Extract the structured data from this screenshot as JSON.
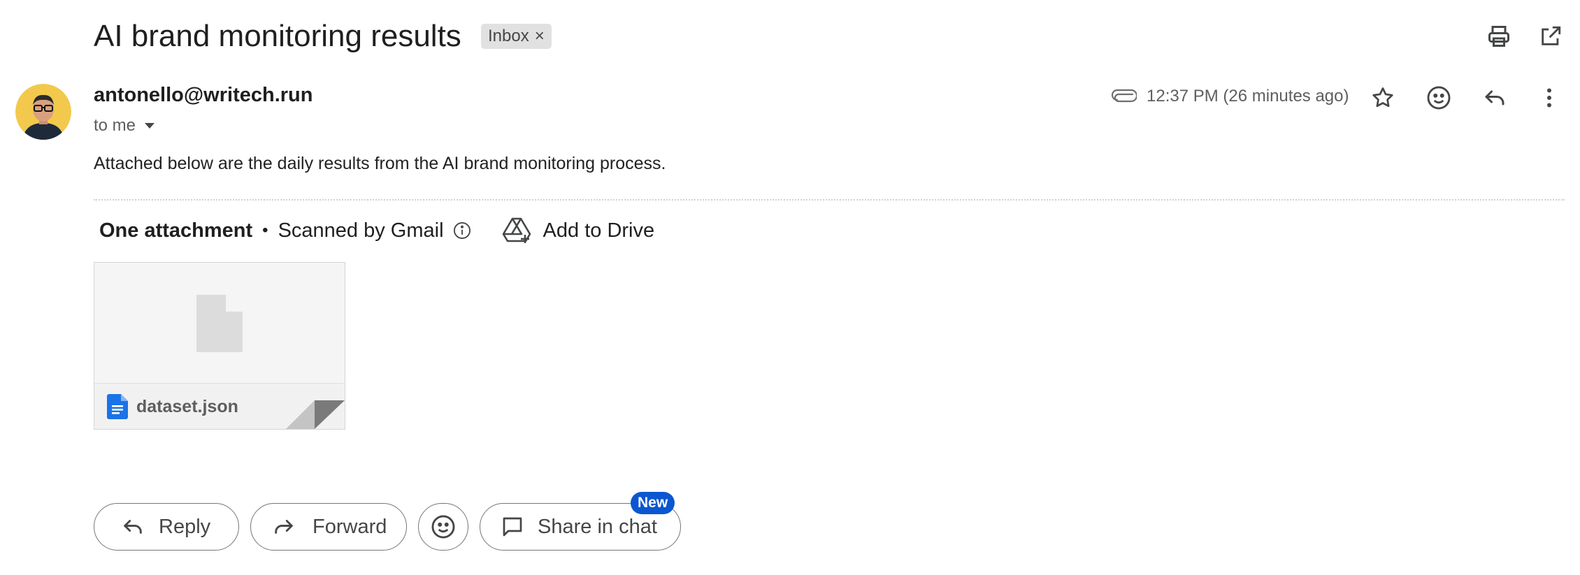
{
  "subject": "AI brand monitoring results",
  "label": "Inbox",
  "label_remove": "×",
  "toolbar": {
    "print_icon": "print-icon",
    "popout_icon": "open-in-new-window-icon"
  },
  "message": {
    "sender": "antonello@writech.run",
    "recipient_line": "to me",
    "timestamp": "12:37 PM (26 minutes ago)",
    "body": "Attached below are the daily results from the AI brand monitoring process."
  },
  "attachments": {
    "count_label": "One attachment",
    "separator": "•",
    "scanned_label": "Scanned by Gmail",
    "add_to_drive_label": "Add to Drive",
    "files": [
      {
        "name": "dataset.json",
        "icon": "google-docs-icon"
      }
    ]
  },
  "actions": {
    "reply_label": "Reply",
    "forward_label": "Forward",
    "share_label": "Share in chat",
    "share_badge": "New"
  },
  "colors": {
    "accent": "#0b57d0",
    "doc_icon": "#1a73e8",
    "chip_bg": "#e1e1e1",
    "avatar_bg": "#f2c94c"
  }
}
